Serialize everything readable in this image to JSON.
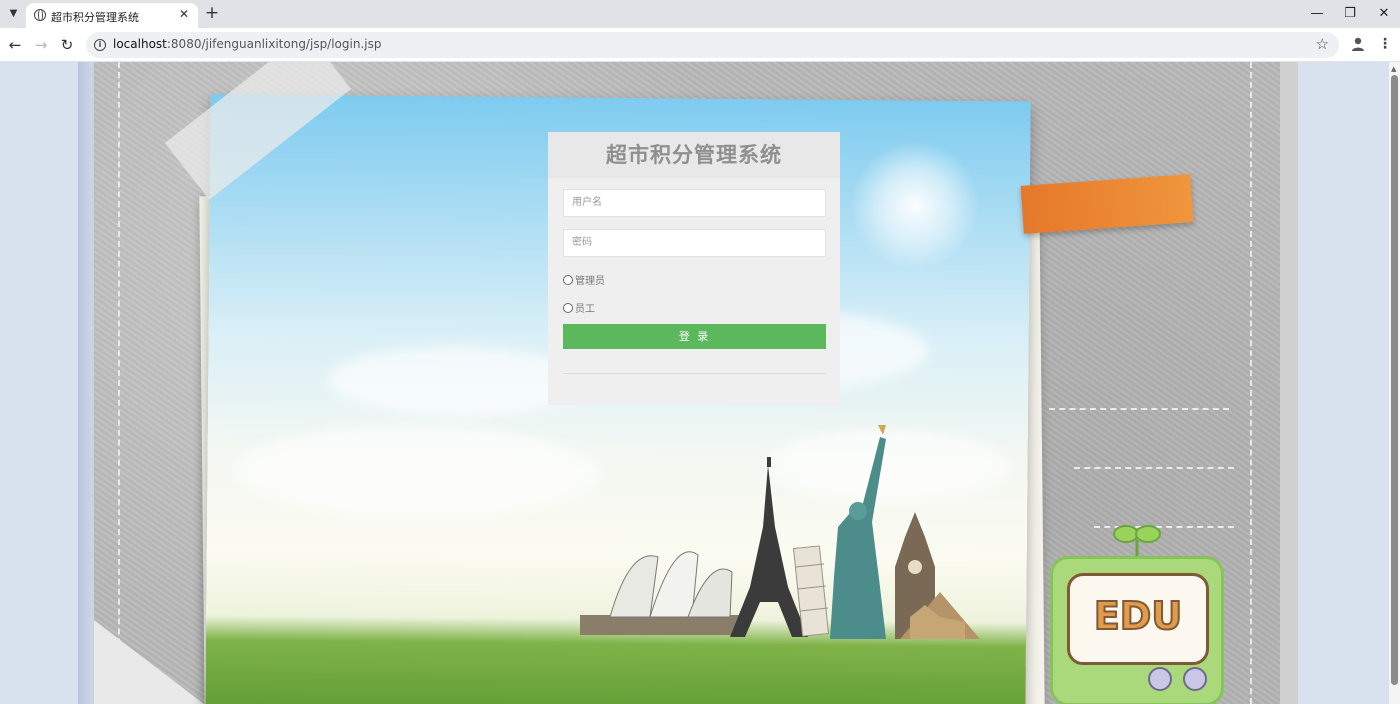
{
  "browser": {
    "tab_title": "超市积分管理系统",
    "url_host": "localhost",
    "url_rest": ":8080/jifenguanlixitong/jsp/login.jsp"
  },
  "login": {
    "title": "超市积分管理系统",
    "username_placeholder": "用户名",
    "password_placeholder": "密码",
    "role_admin": "管理员",
    "role_staff": "员工",
    "submit_label": "登 录"
  },
  "decor": {
    "tv_logo": "EDU"
  },
  "colors": {
    "login_button": "#5cb85c",
    "tape_accent": "#e5782a"
  }
}
